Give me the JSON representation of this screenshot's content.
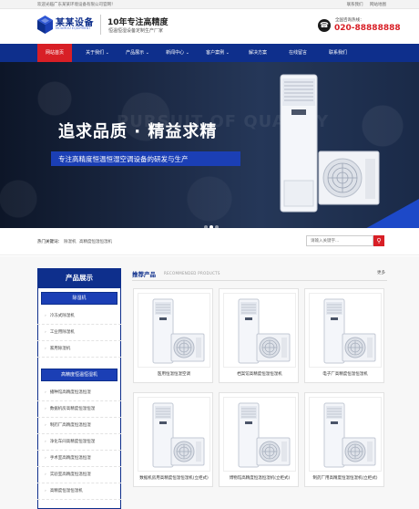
{
  "topbar": {
    "welcome": "欢迎光临广东某某环境设备有限公司官网！",
    "links": [
      "联系我们",
      "网站地图"
    ]
  },
  "header": {
    "logo_text": "某某设备",
    "logo_sub": "MOUMOU EQUIPMENT",
    "slogan_main": "10年专注高精度",
    "slogan_sub": "恒温恒湿设备定制生产厂家",
    "hotline_label": "全国咨询热线：",
    "hotline_number": "020-88888888"
  },
  "nav": {
    "items": [
      "网站首页",
      "关于我们",
      "产品展示",
      "新闻中心",
      "客户案例",
      "解决方案",
      "在线留言",
      "联系我们"
    ],
    "active_index": 0
  },
  "banner": {
    "ghost_text": "PURSUIT OF QUALITY",
    "title": "追求品质 · 精益求精",
    "subtitle": "专注高精度恒温恒湿空调设备的研发与生产",
    "slide_count": 3,
    "active_slide": 1
  },
  "search": {
    "hot_label": "热门关键词：",
    "keywords": [
      "除湿机",
      "高精度恒温恒湿机"
    ],
    "placeholder": "请输入关键字...",
    "button_icon": "search-icon"
  },
  "sidebar": {
    "title": "产品展示",
    "categories": [
      {
        "name": "除湿机",
        "items": [
          "冷冻式除湿机",
          "工业用除湿机",
          "家用除湿机"
        ]
      },
      {
        "name": "高精度恒温恒湿机",
        "items": [
          "播种馆高精度恒温恒湿",
          "数据机房高精度恒温恒湿",
          "制药厂高精度恒温恒湿",
          "净化车间高精度恒温恒湿",
          "手术室高精度恒温恒湿",
          "实验室高精度恒温恒湿",
          "高精度恒温恒湿机"
        ]
      }
    ]
  },
  "recommend": {
    "title": "推荐产品",
    "subtitle": "RECOMMENDED PRODUCTS",
    "more": "更多",
    "products": [
      "医用恒温恒湿空调",
      "档案馆高精度恒温恒湿机",
      "电子厂高精度恒温恒湿机",
      "数据机房用高精度恒温恒湿机(立柜式)",
      "博物馆高精度恒温恒湿机(立柜式)",
      "制药厂用高精度恒温恒湿机(立柜式)"
    ]
  },
  "colors": {
    "brand_blue": "#0e2f8c",
    "accent_red": "#d81f26",
    "banner_blue": "#1b3fb5"
  }
}
